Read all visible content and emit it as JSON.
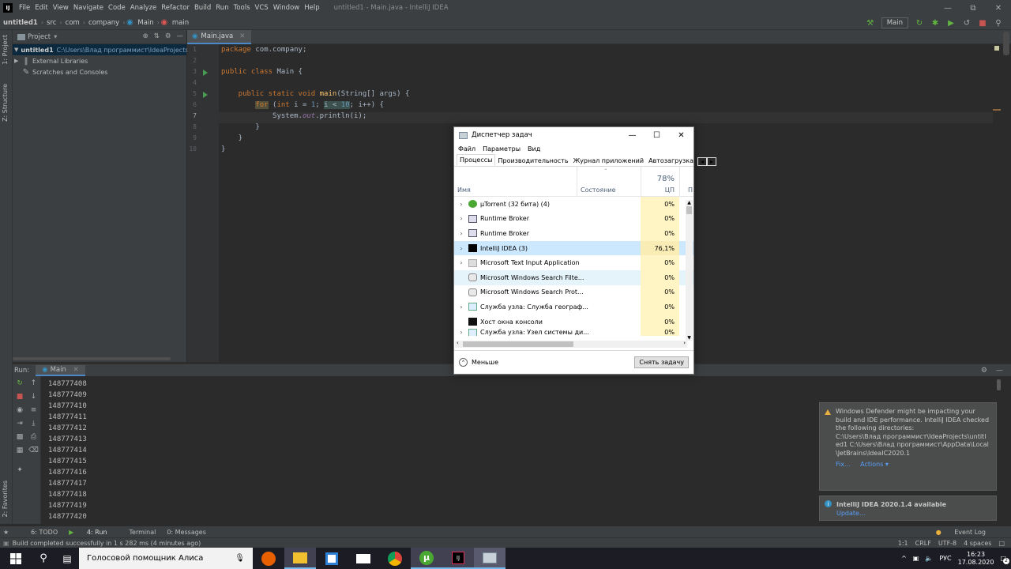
{
  "ide": {
    "title": "untitled1 - Main.java - IntelliJ IDEA",
    "menu": [
      "File",
      "Edit",
      "View",
      "Navigate",
      "Code",
      "Analyze",
      "Refactor",
      "Build",
      "Run",
      "Tools",
      "VCS",
      "Window",
      "Help"
    ],
    "breadcrumbs": [
      "untitled1",
      "src",
      "com",
      "company",
      "Main",
      "main"
    ],
    "run_config": "Main",
    "project_panel": {
      "title": "Project",
      "items": [
        {
          "label": "untitled1",
          "path": "C:\\Users\\Влад программист\\IdeaProjects\\ur"
        },
        {
          "label": "External Libraries"
        },
        {
          "label": "Scratches and Consoles"
        }
      ]
    },
    "side_tabs": {
      "project": "1: Project",
      "structure": "Z: Structure",
      "favorites": "2: Favorites"
    },
    "editor_tab": "Main.java",
    "line_numbers": [
      "1",
      "2",
      "3",
      "4",
      "5",
      "6",
      "7",
      "8",
      "9",
      "10"
    ],
    "code": {
      "l1_pkg_kw": "package",
      "l1_pkg": " com.company;",
      "l3_a": "public class",
      "l3_b": " Main {",
      "l5_a": "    public static void ",
      "l5_fn": "main",
      "l5_b": "(String[] args) {",
      "l6_for": "for",
      "l6_a": " (",
      "l6_int": "int",
      "l6_b": " i = ",
      "l6_one": "1",
      "l6_c": "; ",
      "l6_cond_i": "i < ",
      "l6_ten": "10",
      "l6_d": "; i++) {",
      "l7_a": "            System.",
      "l7_out": "out",
      "l7_b": ".println(i);",
      "l8": "        }",
      "l9": "    }",
      "l10": "}"
    },
    "run_panel": {
      "label": "Run:",
      "config": "Main",
      "output": [
        "148777407",
        "148777408",
        "148777409",
        "148777410",
        "148777411",
        "148777412",
        "148777413",
        "148777414",
        "148777415",
        "148777416",
        "148777417",
        "148777418",
        "148777419",
        "148777420"
      ]
    },
    "bottom_tabs": [
      "6: TODO",
      "4: Run",
      "Terminal",
      "0: Messages"
    ],
    "event_log": "Event Log",
    "status": {
      "message": "Build completed successfully in 1 s 282 ms (4 minutes ago)",
      "position": "1:1",
      "line_sep": "CRLF",
      "encoding": "UTF-8",
      "indent": "4 spaces"
    },
    "notifications": [
      {
        "text": "Windows Defender might be impacting your build and IDE performance. IntelliJ IDEA checked the following directories:",
        "dirs": "C:\\Users\\Влад программист\\IdeaProjects\\untitled1 C:\\Users\\Влад программист\\AppData\\Local\\JetBrains\\IdeaIC2020.1",
        "actions": [
          "Fix...",
          "Actions ▾"
        ]
      },
      {
        "text": "IntelliJ IDEA 2020.1.4 available",
        "actions": [
          "Update..."
        ]
      }
    ]
  },
  "task_manager": {
    "title": "Диспетчер задач",
    "menu": [
      "Файл",
      "Параметры",
      "Вид"
    ],
    "tabs": [
      "Процессы",
      "Производительность",
      "Журнал приложений",
      "Автозагрузка"
    ],
    "columns": {
      "name": "Имя",
      "status": "Состояние",
      "cpu_pct": "78%",
      "cpu": "ЦП",
      "next": "П"
    },
    "processes": [
      {
        "name": "µTorrent (32 бита) (4)",
        "cpu": "0%",
        "expandable": true,
        "icon": "utorrent-icon"
      },
      {
        "name": "Runtime Broker",
        "cpu": "0%",
        "expandable": true,
        "icon": "app-icon"
      },
      {
        "name": "Runtime Broker",
        "cpu": "0%",
        "expandable": true,
        "icon": "app-icon"
      },
      {
        "name": "IntelliJ IDEA (3)",
        "cpu": "76,1%",
        "expandable": true,
        "icon": "intellij-icon"
      },
      {
        "name": "Microsoft Text Input Application",
        "cpu": "0%",
        "expandable": true,
        "icon": "app-icon"
      },
      {
        "name": "Microsoft Windows Search Filte...",
        "cpu": "0%",
        "expandable": false,
        "icon": "search-service-icon"
      },
      {
        "name": "Microsoft Windows Search Prot...",
        "cpu": "0%",
        "expandable": false,
        "icon": "search-service-icon"
      },
      {
        "name": "Служба узла: Служба географ...",
        "cpu": "0%",
        "expandable": true,
        "icon": "service-icon"
      },
      {
        "name": "Хост окна консоли",
        "cpu": "0%",
        "expandable": false,
        "icon": "console-icon"
      },
      {
        "name": "Служба узла: Узел системы ди...",
        "cpu": "0%",
        "expandable": true,
        "icon": "service-icon"
      }
    ],
    "less_label": "Меньше",
    "end_task": "Снять задачу"
  },
  "taskbar": {
    "search_text": "Голосовой помощник Алиса",
    "lang": "РУС",
    "time": "16:23",
    "date": "17.08.2020",
    "notif_count": "2"
  }
}
